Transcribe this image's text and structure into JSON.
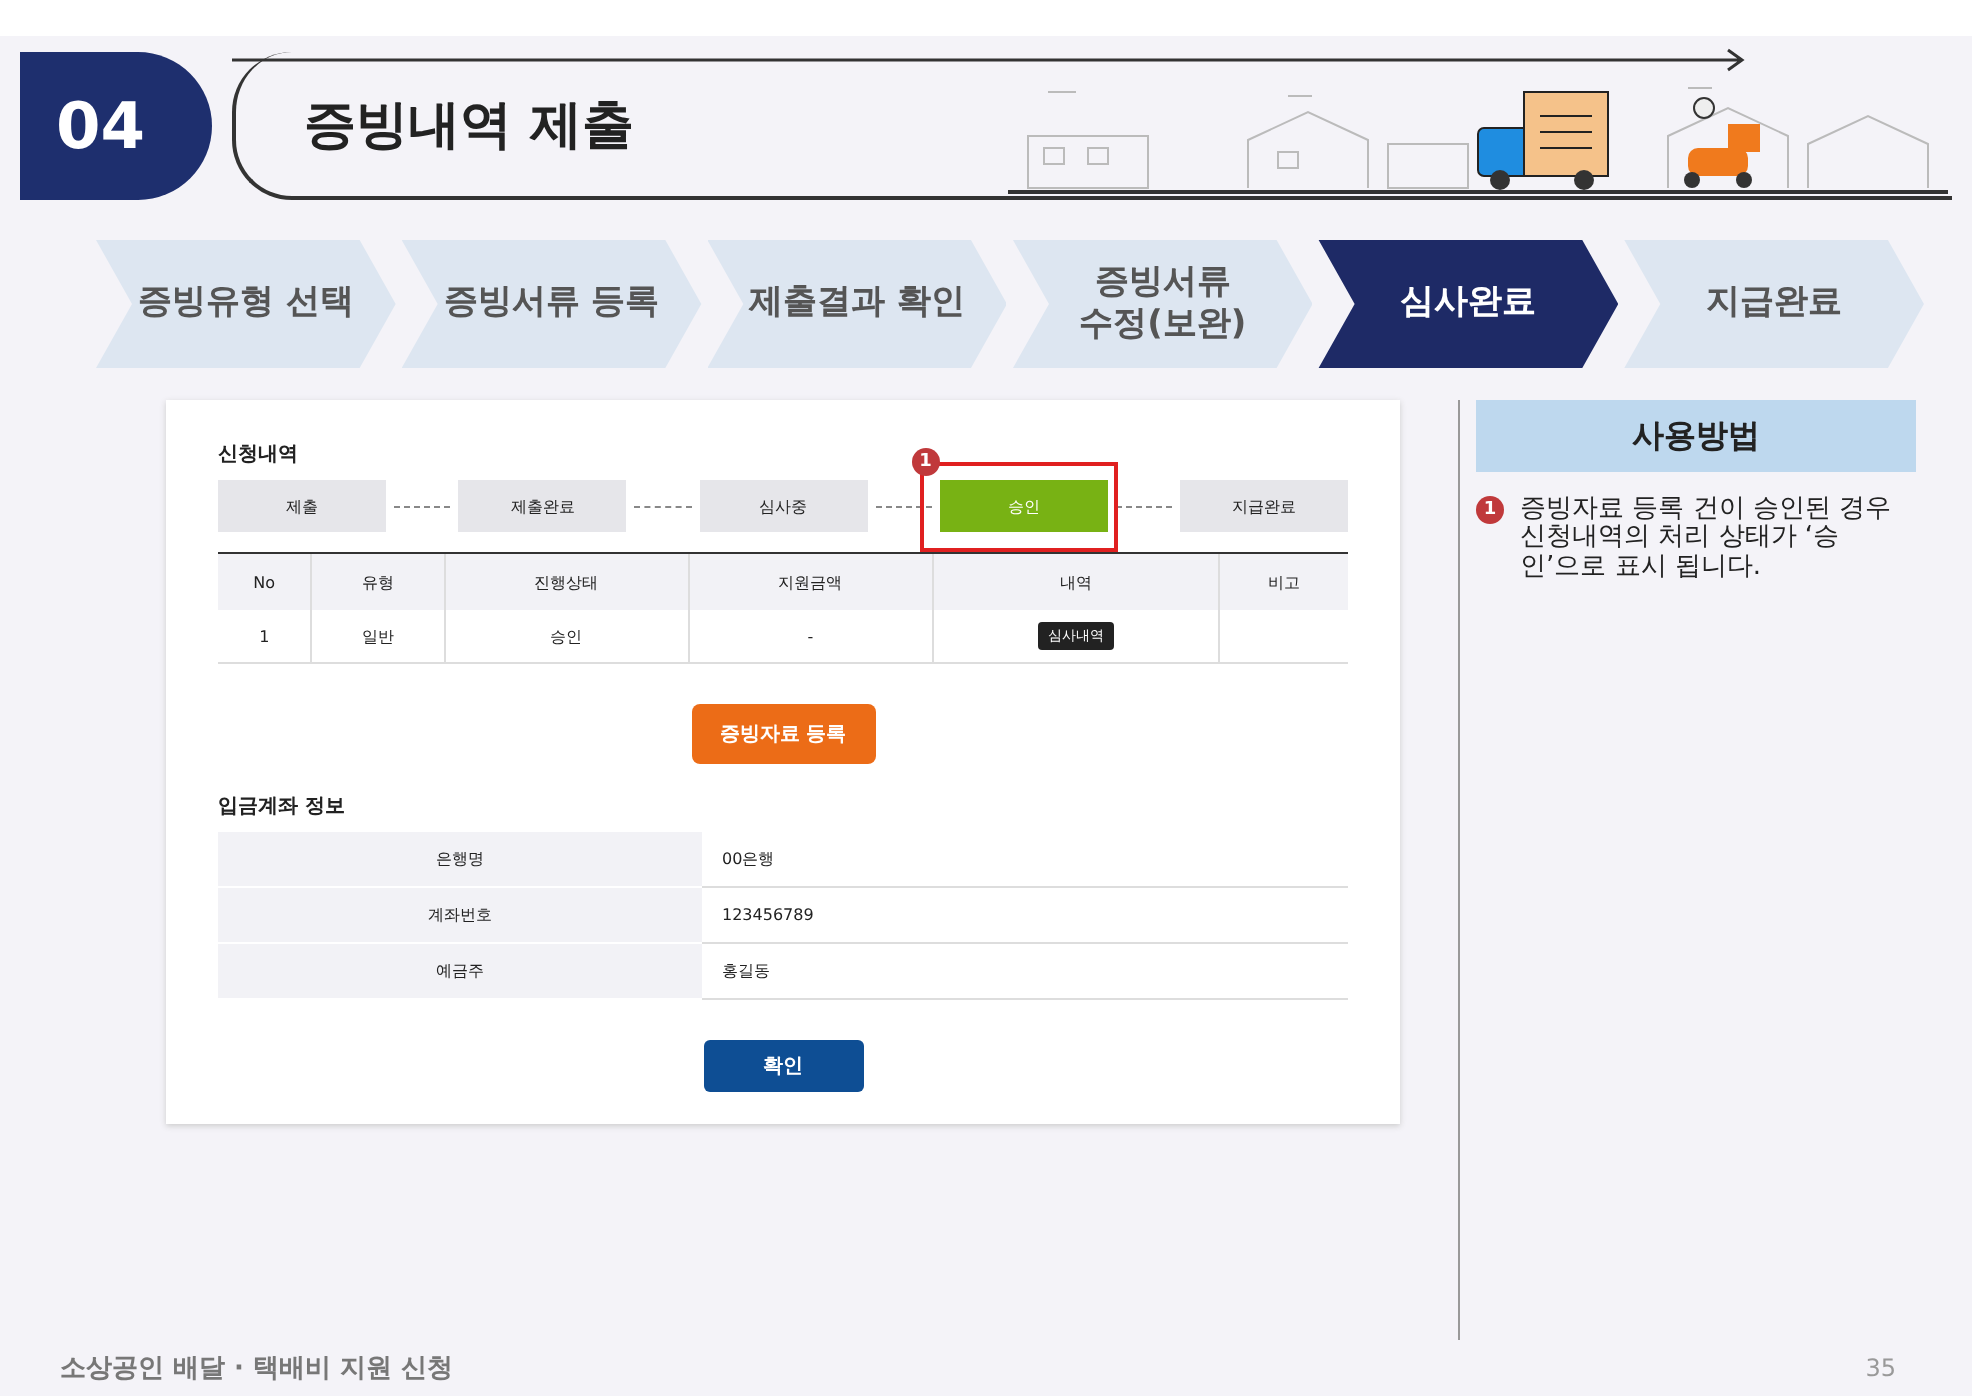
{
  "header": {
    "section_number": "04",
    "title": "증빙내역 제출"
  },
  "steps": [
    {
      "label": "증빙유형 선택",
      "selected": false
    },
    {
      "label": "증빙서류 등록",
      "selected": false
    },
    {
      "label": "제출결과 확인",
      "selected": false
    },
    {
      "label": "증빙서류\n수정(보완)",
      "selected": false
    },
    {
      "label": "심사완료",
      "selected": true
    },
    {
      "label": "지급완료",
      "selected": false
    }
  ],
  "application": {
    "title": "신청내역",
    "highlight_marker": "1",
    "statuses": [
      {
        "label": "제출",
        "selected": false
      },
      {
        "label": "제출완료",
        "selected": false
      },
      {
        "label": "심사중",
        "selected": false
      },
      {
        "label": "승인",
        "selected": true
      },
      {
        "label": "지급완료",
        "selected": false
      }
    ],
    "table": {
      "columns": [
        "No",
        "유형",
        "진행상태",
        "지원금액",
        "내역",
        "비고"
      ],
      "rows": [
        {
          "cells": [
            "1",
            "일반",
            "승인",
            "-"
          ],
          "detail_button": "심사내역"
        }
      ]
    }
  },
  "register_button": "증빙자료 등록",
  "account": {
    "title": "입금계좌 정보",
    "rows": [
      {
        "label": "은행명",
        "value": "00은행"
      },
      {
        "label": "계좌번호",
        "value": "123456789"
      },
      {
        "label": "예금주",
        "value": "홍길동"
      }
    ]
  },
  "confirm_button": "확인",
  "guide": {
    "title": "사용방법",
    "items": [
      {
        "marker": "1",
        "text": "증빙자료 등록 건이 승인된 경우 신청내역의 처리 상태가 ‘승인’으로 표시 됩니다."
      }
    ]
  },
  "footer": {
    "title": "소상공인 배달 · 택배비 지원 신청",
    "page_number": "35"
  }
}
